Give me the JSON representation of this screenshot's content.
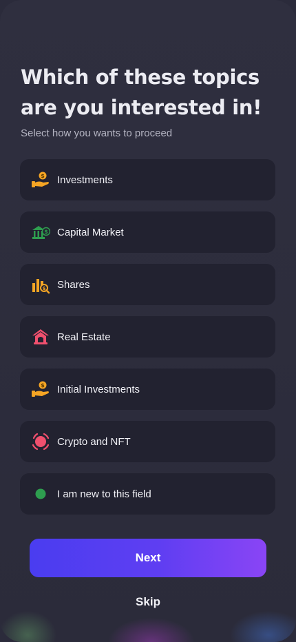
{
  "header": {
    "title": "Which of these topics are you interested in!",
    "subtitle": "Select how you wants to proceed"
  },
  "options": [
    {
      "label": "Investments",
      "icon": "hand-coin-icon"
    },
    {
      "label": "Capital Market",
      "icon": "bank-dollar-icon"
    },
    {
      "label": "Shares",
      "icon": "bar-chart-search-icon"
    },
    {
      "label": "Real Estate",
      "icon": "house-icon"
    },
    {
      "label": "Initial Investments",
      "icon": "hand-coin-icon"
    },
    {
      "label": "Crypto and NFT",
      "icon": "target-record-icon"
    },
    {
      "label": "I am new to this field",
      "icon": "green-dot-icon"
    }
  ],
  "actions": {
    "next_label": "Next",
    "skip_label": "Skip"
  },
  "colors": {
    "primary_gradient_start": "#4a3df0",
    "primary_gradient_end": "#8a45f5",
    "card_bg": "#222230",
    "orange": "#f5a524",
    "green": "#2e9e4f",
    "red": "#f0506e"
  }
}
